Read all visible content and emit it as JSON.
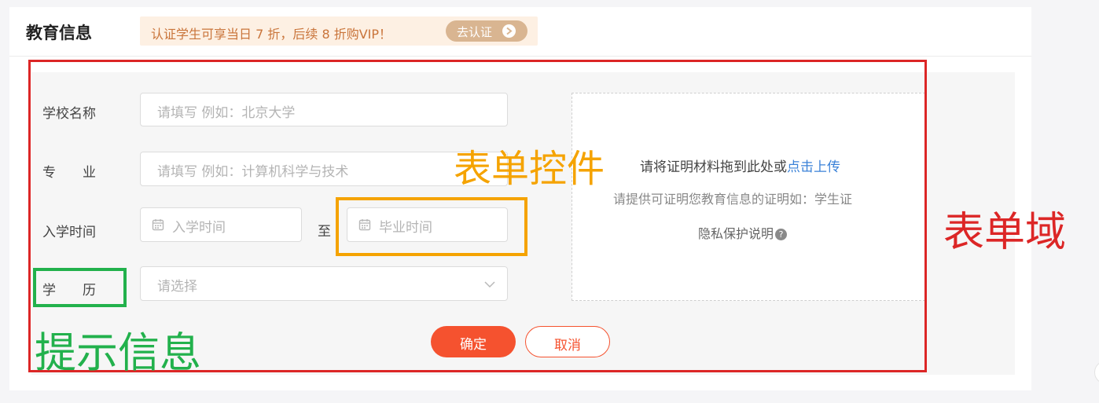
{
  "section": {
    "title": "教育信息"
  },
  "promo": {
    "text": "认证学生可享当日 7 折，后续 8 折购VIP！",
    "button_label": "去认证"
  },
  "form": {
    "school": {
      "label": "学校名称",
      "placeholder": "请填写 例如：北京大学"
    },
    "major": {
      "label": "专　　业",
      "placeholder": "请填写 例如：计算机科学与技术"
    },
    "enroll": {
      "label": "入学时间",
      "start_placeholder": "入学时间",
      "to": "至",
      "end_placeholder": "毕业时间"
    },
    "degree": {
      "label": "学　　历",
      "placeholder": "请选择"
    }
  },
  "upload": {
    "prompt": "请将证明材料拖到此处或",
    "link": "点击上传",
    "hint": "请提供可证明您教育信息的证明如：学生证",
    "privacy": "隐私保护说明",
    "help_icon": "?"
  },
  "actions": {
    "confirm": "确定",
    "cancel": "取消"
  },
  "annotations": {
    "form_control": "表单控件",
    "form_area": "表单域",
    "hint_info": "提示信息"
  },
  "colors": {
    "form_area_border": "#dc2626",
    "form_control_border": "#f5a300",
    "hint_border": "#22b14c",
    "primary": "#f5522f",
    "link": "#3b82d8",
    "promo_text": "#c9743a"
  }
}
